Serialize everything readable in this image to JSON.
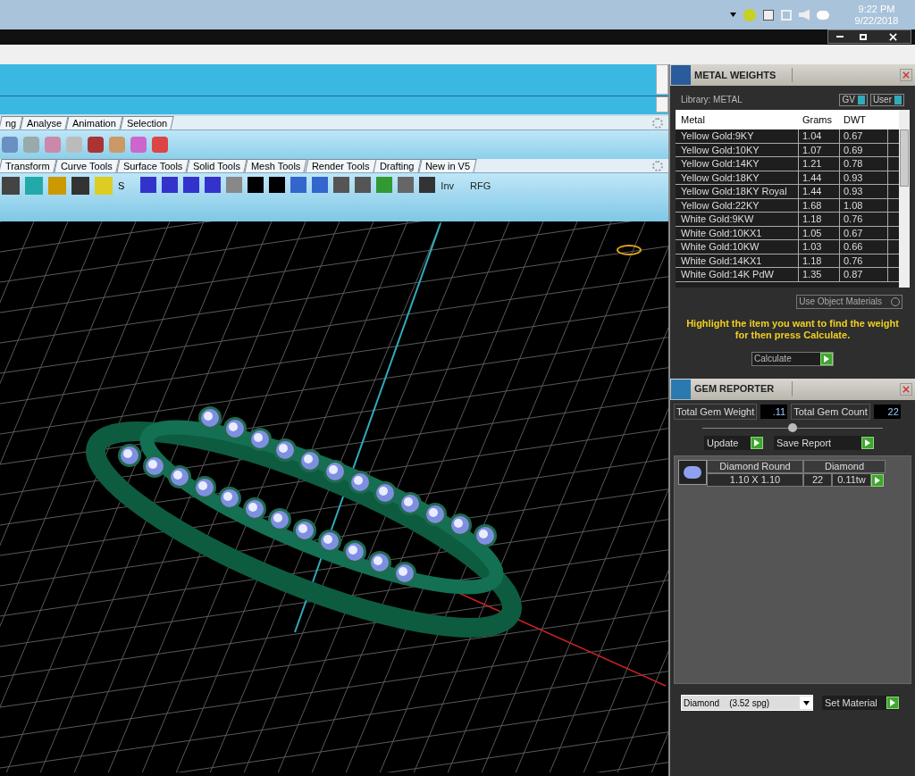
{
  "taskbar": {
    "time": "9:22 PM",
    "date": "9/22/2018"
  },
  "ribbon_tabs_1": [
    {
      "label": "ng"
    },
    {
      "label": "Analyse"
    },
    {
      "label": "Animation"
    },
    {
      "label": "Selection"
    }
  ],
  "ribbon_tabs_2": [
    {
      "label": "Transform"
    },
    {
      "label": "Curve Tools"
    },
    {
      "label": "Surface Tools"
    },
    {
      "label": "Solid Tools"
    },
    {
      "label": "Mesh Tools"
    },
    {
      "label": "Render Tools"
    },
    {
      "label": "Drafting"
    },
    {
      "label": "New in V5"
    }
  ],
  "toolbar_texts": [
    "S",
    "Inv",
    "RFG"
  ],
  "metal_weights": {
    "title": "METAL WEIGHTS",
    "library": "Library: METAL",
    "toggles": [
      "GV",
      "User"
    ],
    "columns": [
      "Metal",
      "Grams",
      "DWT"
    ],
    "rows": [
      [
        "Yellow Gold:9KY",
        "1.04",
        "0.67"
      ],
      [
        "Yellow Gold:10KY",
        "1.07",
        "0.69"
      ],
      [
        "Yellow Gold:14KY",
        "1.21",
        "0.78"
      ],
      [
        "Yellow Gold:18KY",
        "1.44",
        "0.93"
      ],
      [
        "Yellow Gold:18KY Royal",
        "1.44",
        "0.93"
      ],
      [
        "Yellow Gold:22KY",
        "1.68",
        "1.08"
      ],
      [
        "White Gold:9KW",
        "1.18",
        "0.76"
      ],
      [
        "White Gold:10KX1",
        "1.05",
        "0.67"
      ],
      [
        "White Gold:10KW",
        "1.03",
        "0.66"
      ],
      [
        "White Gold:14KX1",
        "1.18",
        "0.76"
      ],
      [
        "White Gold:14K PdW",
        "1.35",
        "0.87"
      ]
    ],
    "use_object_materials": "Use Object Materials",
    "hint": "Highlight the item you want to find the weight for then press Calculate.",
    "calculate": "Calculate"
  },
  "gem_reporter": {
    "title": "GEM REPORTER",
    "weight_label": "Total Gem Weight",
    "weight": ".11",
    "count_label": "Total Gem Count",
    "count": "22",
    "buttons": [
      "Update",
      "Save Report"
    ],
    "gems": [
      {
        "name": "Diamond Round",
        "type": "Diamond",
        "size": "1.10 X 1.10",
        "count": "22",
        "weight": "0.11tw"
      }
    ],
    "material": "Diamond    (3.52 spg)",
    "set_material": "Set Material"
  }
}
